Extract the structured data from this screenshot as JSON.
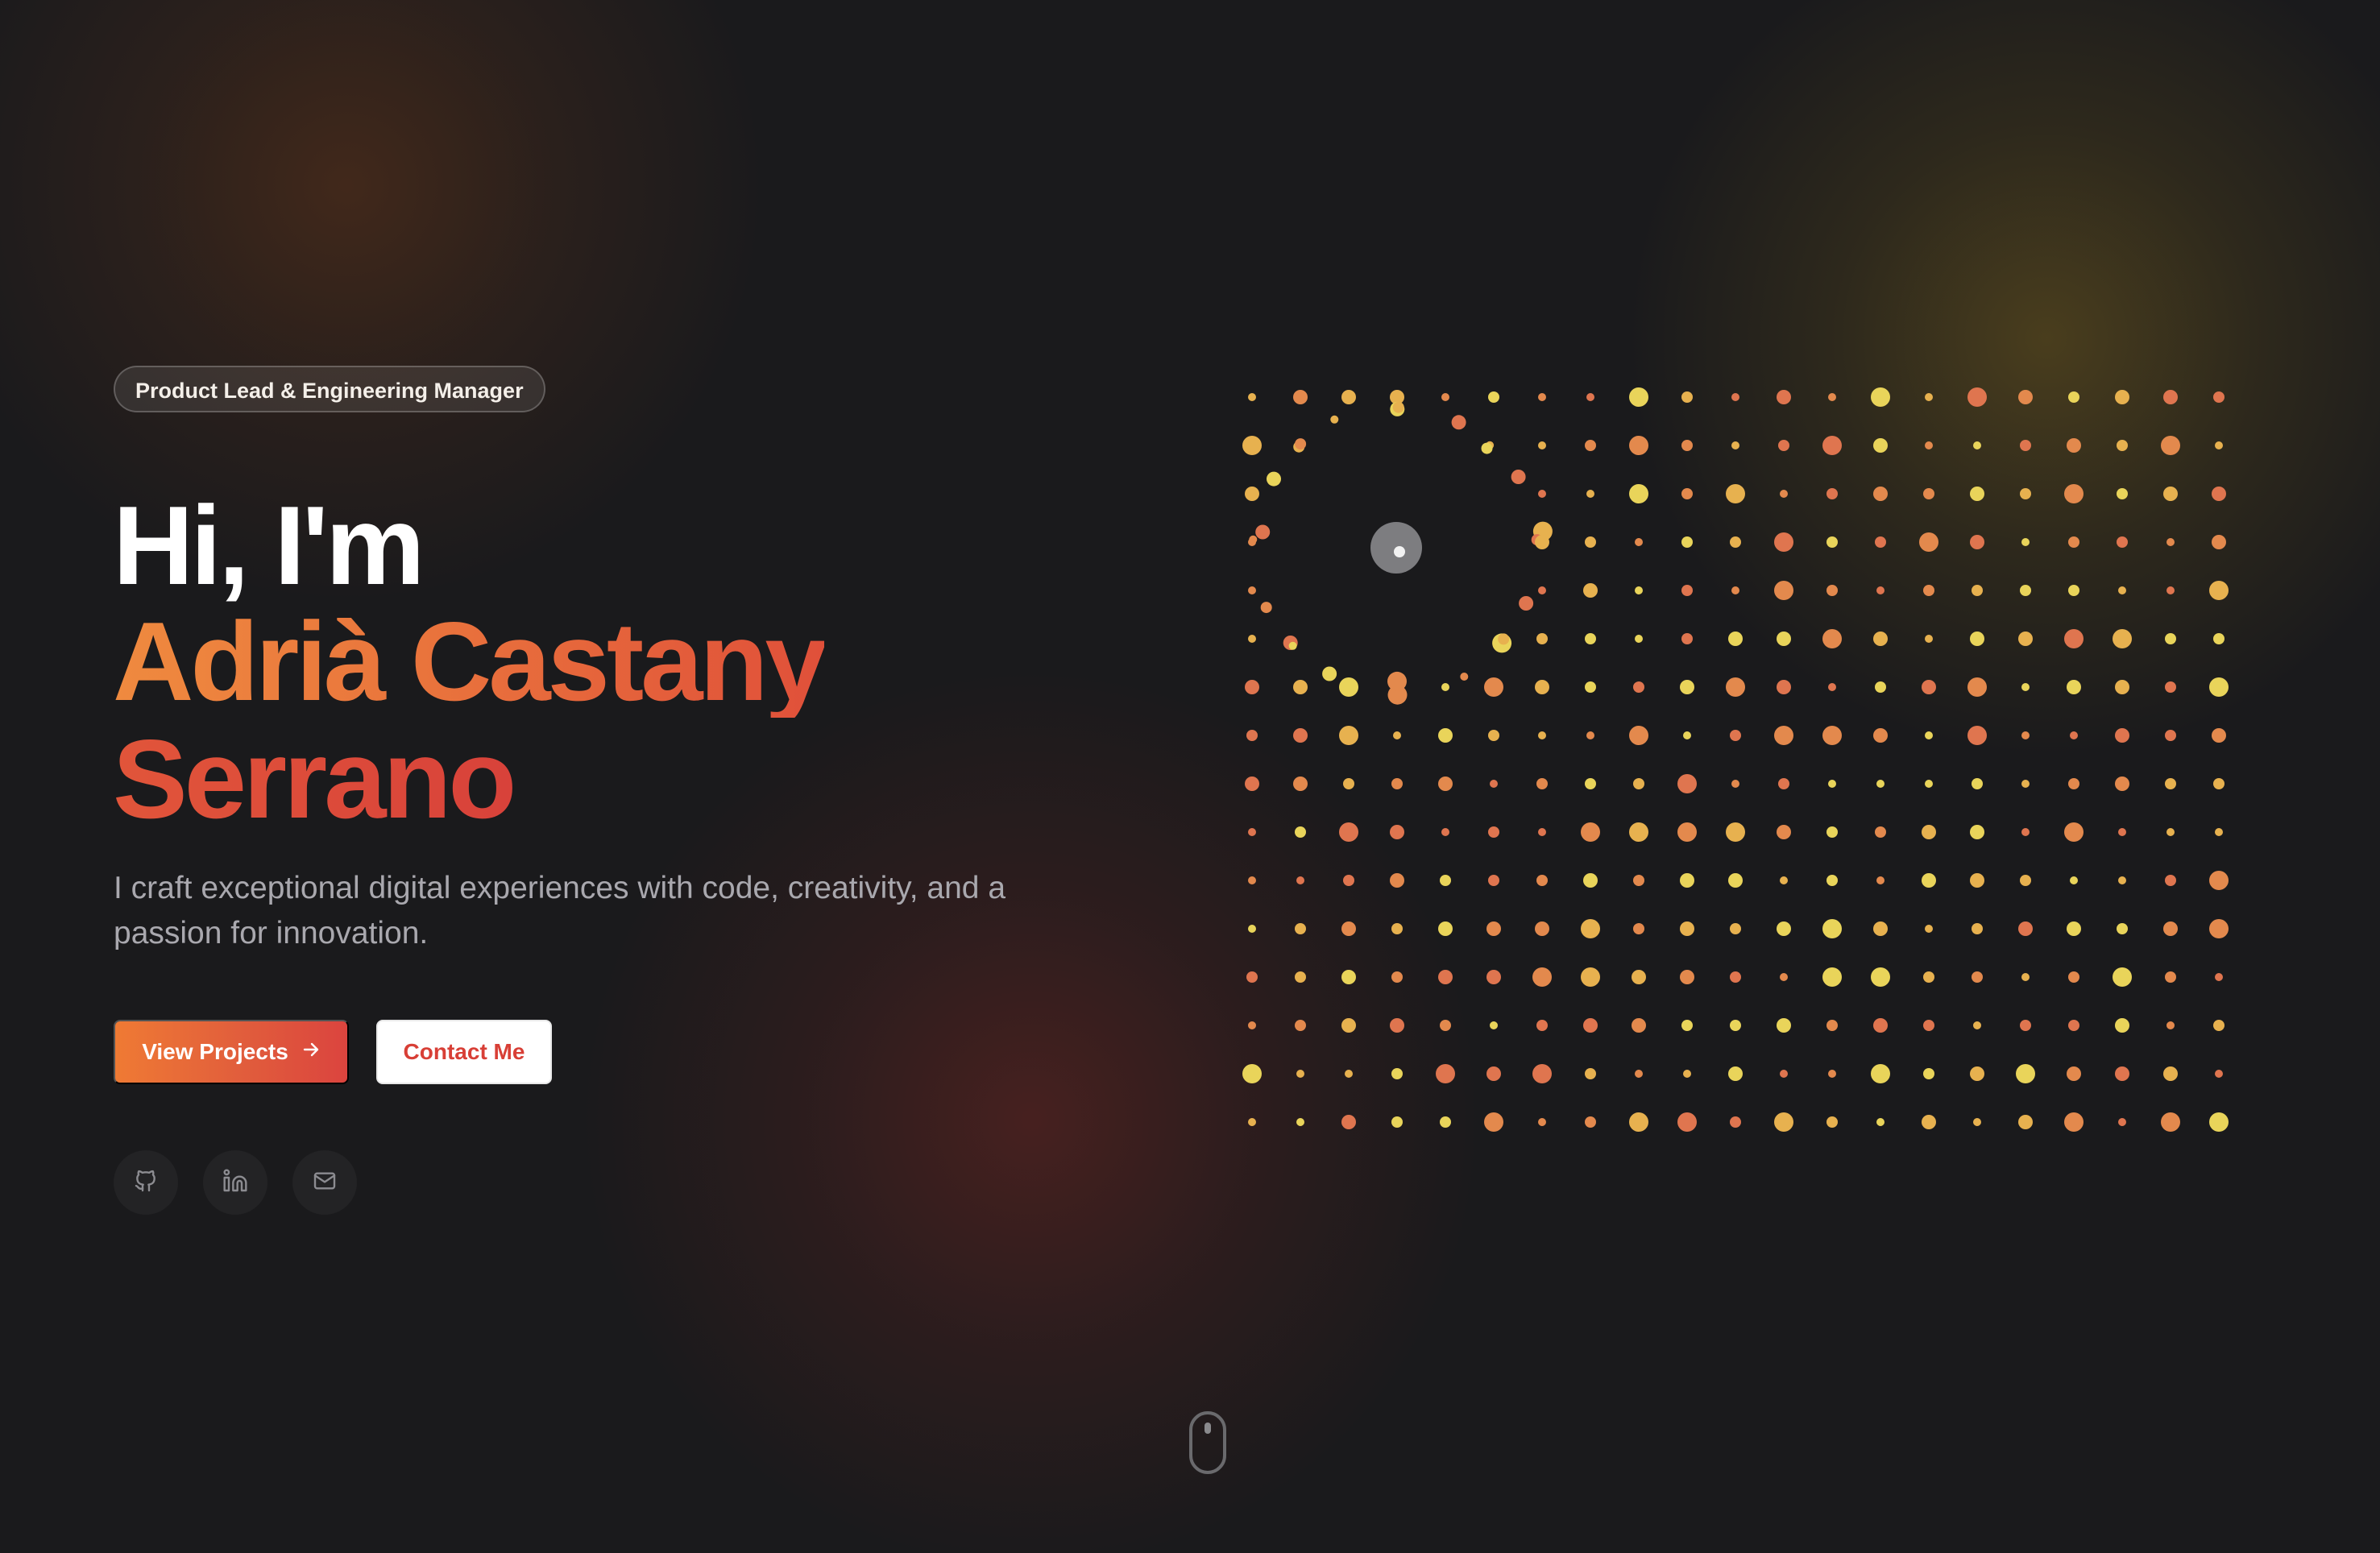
{
  "hero": {
    "badge": "Product Lead & Engineering Manager",
    "greeting": "Hi, I'm",
    "name_line_1": "Adrià Castany",
    "name_line_2": "Serrano",
    "tagline": "I craft exceptional digital experiences with code, creativity, and a passion for innovation."
  },
  "actions": {
    "view_projects": "View Projects",
    "contact": "Contact Me"
  },
  "social": {
    "github_icon": "github-icon",
    "linkedin_icon": "linkedin-icon",
    "email_icon": "mail-icon"
  },
  "colors": {
    "background": "#1a1a1c",
    "orange": "#ef8a3f",
    "red": "#d8423a",
    "yellow": "#e9d45a"
  },
  "visual": {
    "type": "interactive dot grid",
    "rows": 16,
    "columns": 21
  }
}
